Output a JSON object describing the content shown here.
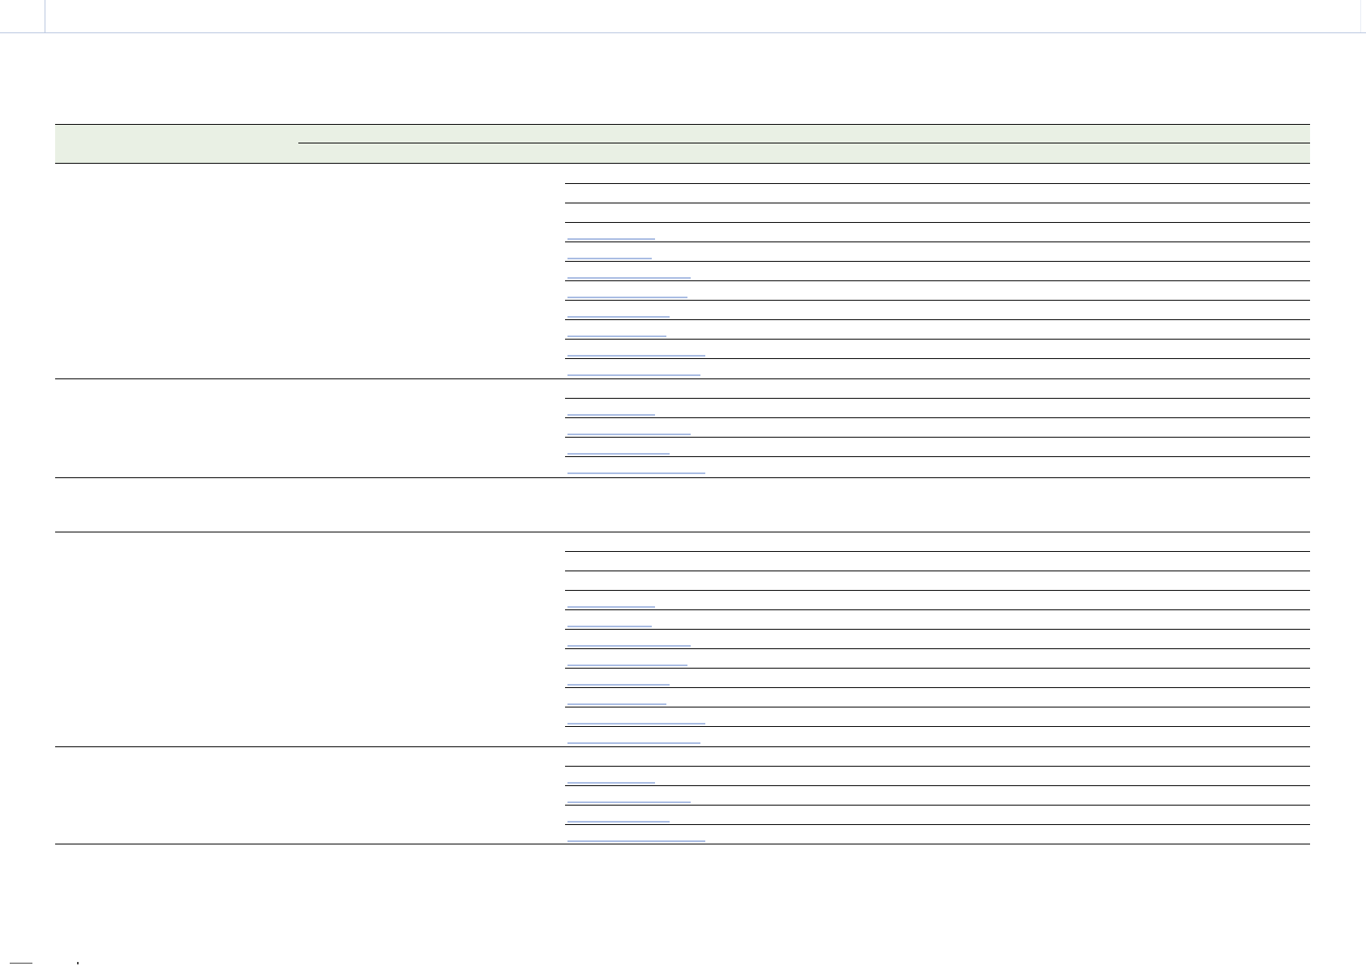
{
  "header": {
    "left_label": "",
    "right_label": "",
    "sub_label": ""
  },
  "sections": [
    {
      "name": "group-1",
      "rows": 11,
      "link_rows": [
        3,
        4,
        5,
        6,
        7,
        8,
        9,
        10
      ]
    },
    {
      "name": "group-2",
      "rows": 5,
      "link_rows": [
        1,
        2,
        3,
        4
      ]
    },
    {
      "name": "group-3",
      "rows": 1,
      "link_rows": []
    },
    {
      "name": "group-4",
      "rows": 11,
      "link_rows": [
        3,
        4,
        5,
        6,
        7,
        8,
        9,
        10
      ]
    },
    {
      "name": "group-5",
      "rows": 5,
      "link_rows": [
        1,
        2,
        3,
        4
      ]
    }
  ],
  "colors": {
    "header_bg": "#e9f0e4",
    "link_underline": "#a9bce3",
    "rule": "#000000"
  }
}
